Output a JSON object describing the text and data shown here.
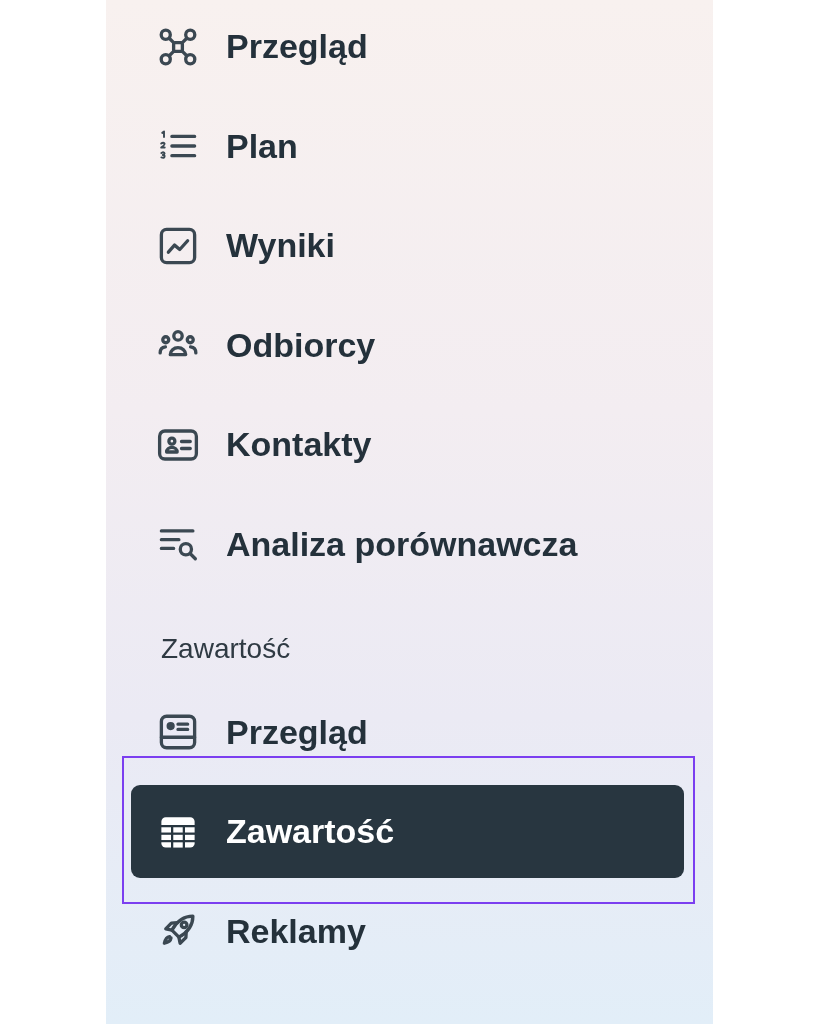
{
  "sidebar": {
    "sections": [
      {
        "items": [
          {
            "label": "Przegląd",
            "selected": false,
            "focused": false
          },
          {
            "label": "Plan",
            "selected": false,
            "focused": false
          },
          {
            "label": "Wyniki",
            "selected": false,
            "focused": false
          },
          {
            "label": "Odbiorcy",
            "selected": false,
            "focused": false
          },
          {
            "label": "Kontakty",
            "selected": false,
            "focused": false
          },
          {
            "label": "Analiza porównawcza",
            "selected": false,
            "focused": false
          }
        ]
      },
      {
        "heading": "Zawartość",
        "items": [
          {
            "label": "Przegląd",
            "selected": false,
            "focused": false
          },
          {
            "label": "Zawartość",
            "selected": true,
            "focused": true
          },
          {
            "label": "Reklamy",
            "selected": false,
            "focused": false
          }
        ]
      }
    ]
  }
}
